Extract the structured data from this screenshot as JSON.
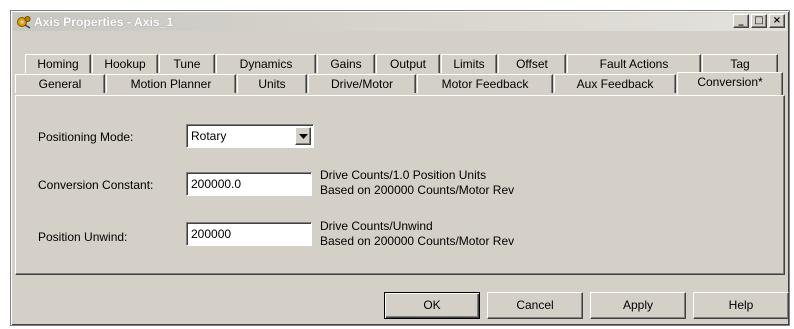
{
  "window": {
    "title": "Axis Properties - Axis_1"
  },
  "title_buttons": {
    "minimize": "_",
    "maximize": "□",
    "close": "×"
  },
  "tabs_row1": [
    {
      "label": "Homing"
    },
    {
      "label": "Hookup"
    },
    {
      "label": "Tune"
    },
    {
      "label": "Dynamics"
    },
    {
      "label": "Gains"
    },
    {
      "label": "Output"
    },
    {
      "label": "Limits"
    },
    {
      "label": "Offset"
    },
    {
      "label": "Fault Actions"
    },
    {
      "label": "Tag"
    }
  ],
  "tabs_row2": [
    {
      "label": "General"
    },
    {
      "label": "Motion Planner"
    },
    {
      "label": "Units"
    },
    {
      "label": "Drive/Motor"
    },
    {
      "label": "Motor Feedback"
    },
    {
      "label": "Aux Feedback"
    },
    {
      "label": "Conversion*"
    }
  ],
  "form": {
    "positioning_mode": {
      "label": "Positioning Mode:",
      "value": "Rotary"
    },
    "conversion_constant": {
      "label": "Conversion Constant:",
      "value": "200000.0",
      "desc1": "Drive Counts/1.0 Position Units",
      "desc2": "Based on 200000 Counts/Motor Rev"
    },
    "position_unwind": {
      "label": "Position Unwind:",
      "value": "200000",
      "desc1": "Drive Counts/Unwind",
      "desc2": "Based on 200000 Counts/Motor Rev"
    }
  },
  "buttons": {
    "ok": "OK",
    "cancel": "Cancel",
    "apply": "Apply",
    "help": "Help"
  },
  "colors": {
    "face": "#d4d0c8",
    "shadow": "#808080",
    "highlight": "#ffffff",
    "title_text": "#ffffff"
  }
}
